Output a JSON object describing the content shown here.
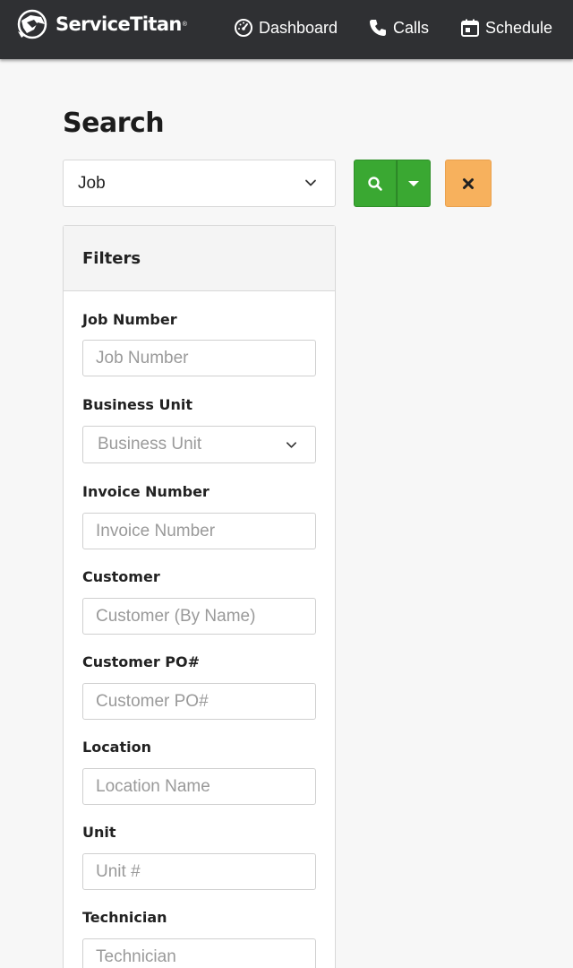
{
  "brand": {
    "name": "ServiceTitan",
    "registered": "®"
  },
  "nav": {
    "dashboard": "Dashboard",
    "calls": "Calls",
    "schedule": "Schedule"
  },
  "icons": {
    "logo": "titan-logo-icon",
    "dashboard": "speedometer-icon",
    "calls": "phone-icon",
    "schedule": "calendar-icon",
    "search": "search-icon",
    "dropdown": "caret-down-icon",
    "clear": "close-icon",
    "select": "chevron-down-icon"
  },
  "colors": {
    "topbar": "#2f3033",
    "search_button": "#3aa832",
    "clear_button": "#f7b15d",
    "page_background": "#f7f7f7"
  },
  "page": {
    "title": "Search"
  },
  "search": {
    "type_selected": "Job"
  },
  "filters": {
    "header": "Filters",
    "fields": [
      {
        "label": "Job Number",
        "placeholder": "Job Number"
      },
      {
        "label": "Business Unit",
        "placeholder": "Business Unit"
      },
      {
        "label": "Invoice Number",
        "placeholder": "Invoice Number"
      },
      {
        "label": "Customer",
        "placeholder": "Customer (By Name)"
      },
      {
        "label": "Customer PO#",
        "placeholder": "Customer PO#"
      },
      {
        "label": "Location",
        "placeholder": "Location Name"
      },
      {
        "label": "Unit",
        "placeholder": "Unit #"
      },
      {
        "label": "Technician",
        "placeholder": "Technician"
      }
    ]
  }
}
